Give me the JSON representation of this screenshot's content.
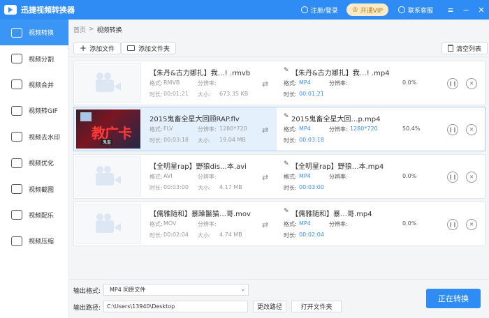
{
  "titlebar": {
    "app_title": "迅捷视频转换器",
    "login": "注册/登录",
    "vip": "开通VIP",
    "service": "联系客服"
  },
  "sidebar": {
    "items": [
      {
        "label": "视频转换",
        "icon": "video-convert-icon",
        "active": true
      },
      {
        "label": "视频分割",
        "icon": "video-split-icon"
      },
      {
        "label": "视频合并",
        "icon": "video-merge-icon"
      },
      {
        "label": "视频转GIF",
        "icon": "gif-icon"
      },
      {
        "label": "视频去水印",
        "icon": "watermark-icon"
      },
      {
        "label": "视频优化",
        "icon": "optimize-icon"
      },
      {
        "label": "视频截图",
        "icon": "screenshot-icon"
      },
      {
        "label": "视频配乐",
        "icon": "music-icon"
      },
      {
        "label": "视频压缩",
        "icon": "compress-icon"
      }
    ]
  },
  "breadcrumb": {
    "home": "首页",
    "sep": ">",
    "current": "视频转换"
  },
  "toolbar": {
    "add_file": "添加文件",
    "add_folder": "添加文件夹",
    "clear_list": "清空列表"
  },
  "labels": {
    "format": "格式:",
    "resolution": "分辨率:",
    "duration": "时长:",
    "size": "大小:"
  },
  "files": [
    {
      "src_name": "【朱丹&古力娜扎】我…! .rmvb",
      "src_format": "RMVB",
      "src_resolution": "",
      "src_duration": "00:01:21",
      "src_size": "673.35 KB",
      "dst_name": "【朱丹&古力娜扎】我…! .mp4",
      "dst_format": "MP4",
      "dst_resolution": "",
      "dst_duration": "00:01:21",
      "progress": "0.0%"
    },
    {
      "src_name": "2015鬼畜全星大回顾RAP.flv",
      "src_format": "FLV",
      "src_resolution": "1280*720",
      "src_duration": "00:03:18",
      "src_size": "19.04 MB",
      "dst_name": "2015鬼畜全星大回…p.mp4",
      "dst_format": "MP4",
      "dst_resolution": "1280*720",
      "dst_duration": "00:03:18",
      "progress": "50.4%"
    },
    {
      "src_name": "【全明星rap】野狼dis…本.avi",
      "src_format": "AVI",
      "src_resolution": "",
      "src_duration": "00:03:00",
      "src_size": "4.17 MB",
      "dst_name": "【全明星rap】野狼…本.mp4",
      "dst_format": "MP4",
      "dst_resolution": "",
      "dst_duration": "00:03:00",
      "progress": "0.0%"
    },
    {
      "src_name": "【儒雅随和】暴躁鬣猫…哥.mov",
      "src_format": "MOV",
      "src_resolution": "",
      "src_duration": "00:02:04",
      "src_size": "4.74 MB",
      "dst_name": "【儒雅随和】暴…哥.mp4",
      "dst_format": "MP4",
      "dst_resolution": "",
      "dst_duration": "00:02:04",
      "progress": "0.0%"
    }
  ],
  "video_thumb": {
    "big_text": "教广卡",
    "small_text": "鬼畜"
  },
  "bottom": {
    "format_label": "输出格式:",
    "format_value": "MP4  同原文件",
    "path_label": "输出路径:",
    "path_value": "C:\\Users\\13940\\Desktop",
    "change_path": "更改路径",
    "open_folder": "打开文件夹",
    "convert": "正在转换"
  },
  "colors": {
    "accent": "#2f8cf4",
    "link_value": "#3a8ef0",
    "vip_bg": "#fcebc4"
  }
}
